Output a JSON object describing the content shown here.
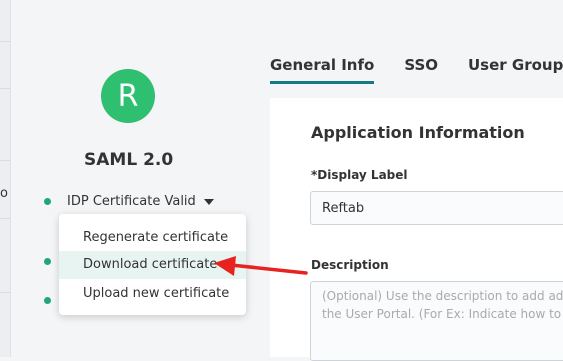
{
  "sidebar_fragment": {
    "letter": "o"
  },
  "app": {
    "avatar_letter": "R",
    "avatar_color": "#2fbf71",
    "name": "SAML 2.0",
    "certificate_status": "IDP Certificate Valid",
    "status_color": "#21a67a"
  },
  "certificate_menu": {
    "items": [
      {
        "label": "Regenerate certificate"
      },
      {
        "label": "Download certificate",
        "highlighted": true
      },
      {
        "label": "Upload new certificate"
      }
    ]
  },
  "tabs": [
    {
      "label": "General Info",
      "active": true
    },
    {
      "label": "SSO"
    },
    {
      "label": "User Groups"
    }
  ],
  "accent_color": "#137a84",
  "form": {
    "section_title": "Application Information",
    "display_label": {
      "label": "*Display Label",
      "value": "Reftab"
    },
    "description": {
      "label": "Description",
      "placeholder": "(Optional) Use the description to add additional information in\nthe User Portal. (For Ex: Indicate how to access the application)"
    }
  },
  "annotation": {
    "type": "arrow",
    "color": "#e8231f",
    "points_to": "Download certificate"
  }
}
